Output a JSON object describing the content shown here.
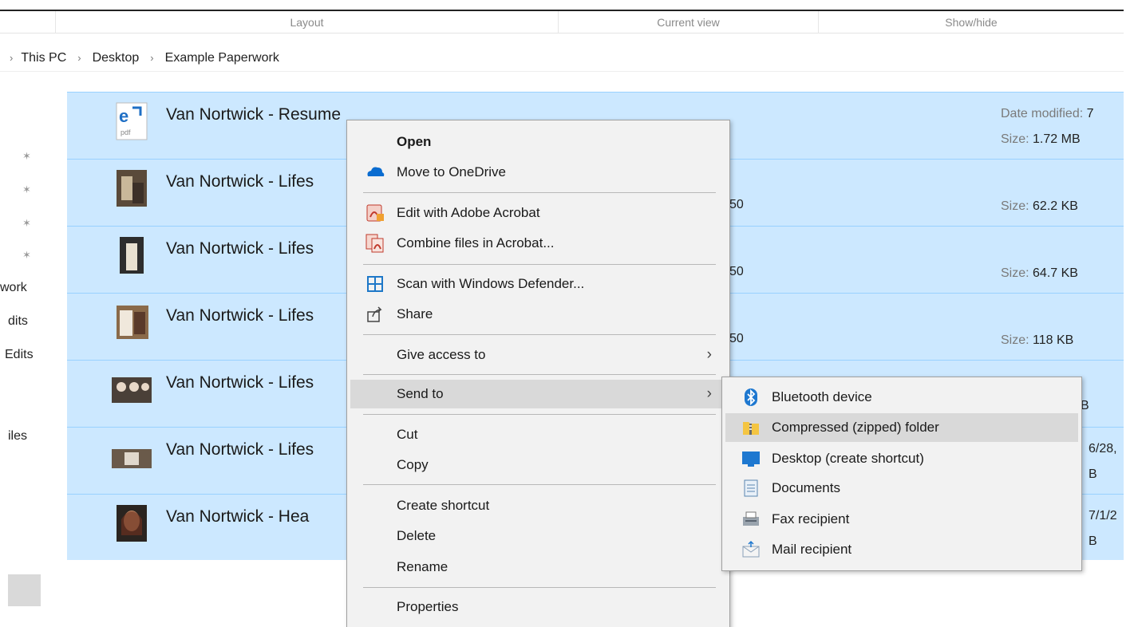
{
  "ribbon": {
    "groups": [
      "Layout",
      "Current view",
      "Show/hide"
    ]
  },
  "address": {
    "crumbs": [
      "This PC",
      "Desktop",
      "Example Paperwork"
    ]
  },
  "nav": {
    "items": [
      "work",
      "dits",
      "Edits",
      "iles"
    ]
  },
  "files": [
    {
      "name": "Van Nortwick - Resume",
      "date_label": "Date modified:",
      "date_value": "7",
      "size_label": "Size:",
      "size_value": "1.72 MB"
    },
    {
      "name": "Van Nortwick - Lifes",
      "trunc_mid": "50",
      "size_label": "Size:",
      "size_value": "62.2 KB"
    },
    {
      "name": "Van Nortwick - Lifes",
      "trunc_mid": "50",
      "size_label": "Size:",
      "size_value": "64.7 KB"
    },
    {
      "name": "Van Nortwick - Lifes",
      "trunc_mid": "50",
      "size_label": "Size:",
      "size_value": "118 KB"
    },
    {
      "name": "Van Nortwick - Lifes",
      "trunc_right": "B"
    },
    {
      "name": "Van Nortwick - Lifes",
      "trunc_right_top": "6/28,",
      "trunc_right": "B"
    },
    {
      "name": "Van Nortwick - Hea",
      "trunc_right_top": "7/1/2",
      "trunc_right": "B"
    }
  ],
  "context_menu": {
    "open": "Open",
    "move_onedrive": "Move to OneDrive",
    "edit_acrobat": "Edit with Adobe Acrobat",
    "combine_acrobat": "Combine files in Acrobat...",
    "scan_defender": "Scan with Windows Defender...",
    "share": "Share",
    "give_access": "Give access to",
    "send_to": "Send to",
    "cut": "Cut",
    "copy": "Copy",
    "create_shortcut": "Create shortcut",
    "delete": "Delete",
    "rename": "Rename",
    "properties": "Properties"
  },
  "send_to_menu": {
    "bluetooth": "Bluetooth device",
    "compressed": "Compressed (zipped) folder",
    "desktop": "Desktop (create shortcut)",
    "documents": "Documents",
    "fax": "Fax recipient",
    "mail": "Mail recipient"
  },
  "colors": {
    "selection": "#cce8ff",
    "selection_border": "#99d1ff",
    "menu_bg": "#f2f2f2",
    "menu_hover": "#d9d9d9"
  }
}
